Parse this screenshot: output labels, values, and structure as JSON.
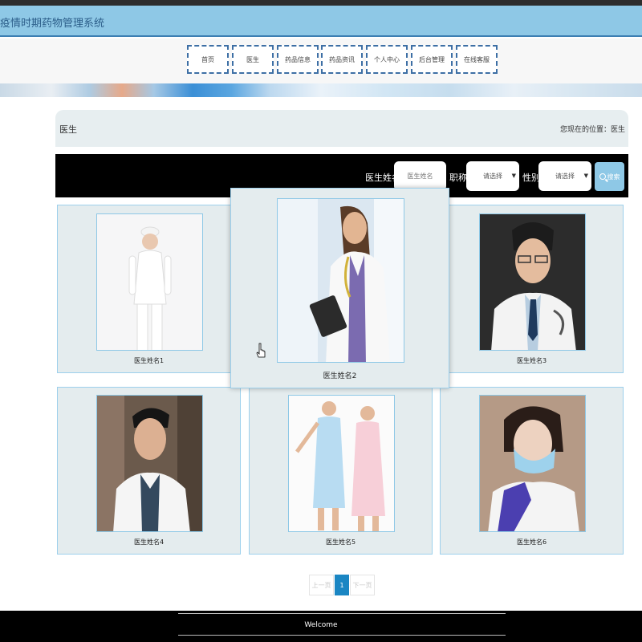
{
  "app": {
    "title": "疫情时期药物管理系统"
  },
  "nav": {
    "items": [
      {
        "label": "首页"
      },
      {
        "label": "医生"
      },
      {
        "label": "药品信息"
      },
      {
        "label": "药品资讯"
      },
      {
        "label": "个人中心"
      },
      {
        "label": "后台管理"
      },
      {
        "label": "在线客服"
      }
    ]
  },
  "section": {
    "title": "医生",
    "breadcrumb": "您现在的位置：医生"
  },
  "search": {
    "name_label": "医生姓名",
    "name_placeholder": "医生姓名",
    "title_label": "职称",
    "title_select": "请选择",
    "gender_label": "性别",
    "gender_select": "请选择",
    "button_label": "搜索"
  },
  "doctors": [
    {
      "name": "医生姓名1"
    },
    {
      "name": "医生姓名2"
    },
    {
      "name": "医生姓名3"
    },
    {
      "name": "医生姓名4"
    },
    {
      "name": "医生姓名5"
    },
    {
      "name": "医生姓名6"
    }
  ],
  "pagination": {
    "prev": "上一页",
    "current": "1",
    "next": "下一页"
  },
  "footer": {
    "text": "Welcome"
  },
  "colors": {
    "accent": "#8ec8e6",
    "nav_border": "#3d6fa5",
    "card_bg": "#e4ecee",
    "page_active": "#1a86c3"
  }
}
